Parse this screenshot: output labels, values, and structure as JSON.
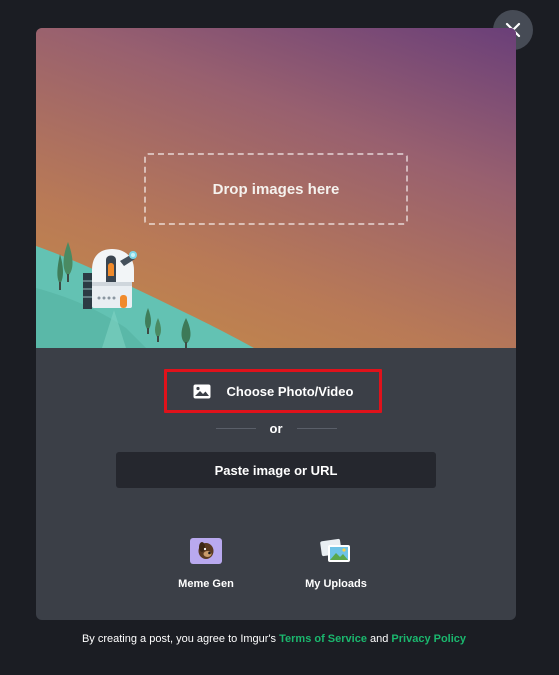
{
  "close": {
    "icon": "close-icon"
  },
  "hero": {
    "drop_label": "Drop images here",
    "gradient_top": "#6a3f79",
    "gradient_bottom": "#c48b47"
  },
  "upload": {
    "choose_label": "Choose Photo/Video",
    "choose_icon": "image-icon",
    "highlight_color": "#e0121b",
    "or_label": "or",
    "paste_label": "Paste image or URL"
  },
  "tools": [
    {
      "label": "Meme Gen",
      "icon": "meme-gen-icon"
    },
    {
      "label": "My Uploads",
      "icon": "my-uploads-icon"
    }
  ],
  "footer": {
    "prefix": "By creating a post, you agree to Imgur's ",
    "terms": "Terms of Service",
    "and": " and ",
    "privacy": "Privacy Policy",
    "link_color": "#1bb76e"
  }
}
